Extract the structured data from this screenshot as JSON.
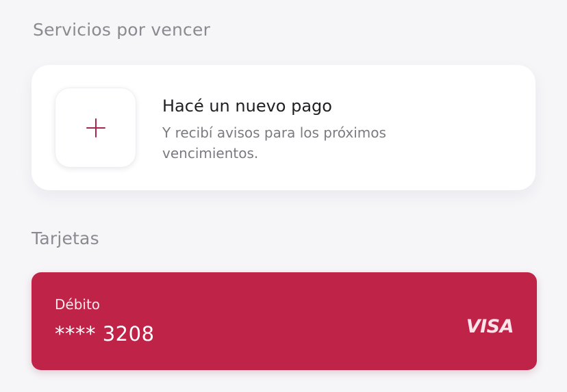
{
  "sections": {
    "services_title": "Servicios por vencer",
    "cards_title": "Tarjetas"
  },
  "new_payment": {
    "title": "Hacé un nuevo pago",
    "subtitle": "Y recibí avisos para los próximos vencimientos.",
    "icon": "plus-icon"
  },
  "card": {
    "type": "Débito",
    "number": "**** 3208",
    "brand": "VISA",
    "color": "#bf2448"
  },
  "colors": {
    "background": "#f6f6f9",
    "accent": "#bf2448"
  }
}
